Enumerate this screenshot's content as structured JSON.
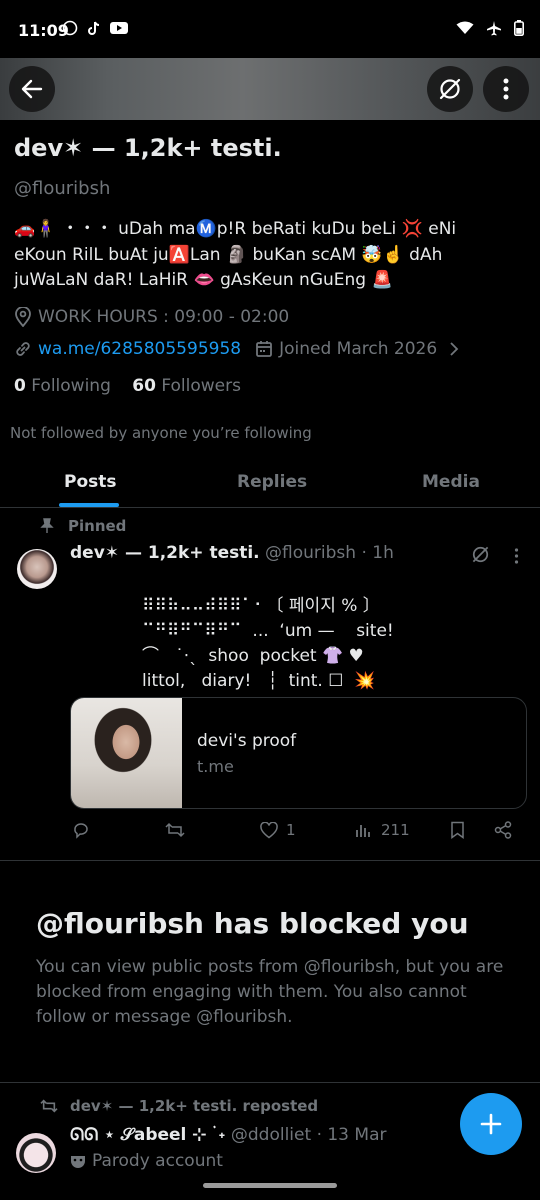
{
  "status": {
    "time": "11:09",
    "left_icons": [
      "whatsapp-icon",
      "tiktok-icon",
      "youtube-icon"
    ],
    "right_icons": [
      "wifi-icon",
      "airplane-icon",
      "battery-icon"
    ]
  },
  "profile": {
    "name": "dev✶ — 1,2k+ testi.",
    "handle": "@flouribsh",
    "bio": "🚗🧍‍♀️ ・・・ uDah maⓂ️p!R beRati kuDu beLi 💢 eNi eKoun RilL buAt ju🅰️Lan 🗿 buKan scAM 🤯☝️ dAh juWaLaN daR! LaHiR 👄 gAsKeun nGuEng 🚨",
    "location": "WORK HOURS : 09:00 - 02:00",
    "website": "wa.me/6285805595958",
    "joined": "Joined March 2026",
    "following_count": "0",
    "following_label": "Following",
    "followers_count": "60",
    "followers_label": "Followers",
    "not_followed": "Not followed by anyone you’re following"
  },
  "tabs": [
    {
      "label": "Posts",
      "active": true
    },
    {
      "label": "Replies",
      "active": false
    },
    {
      "label": "Media",
      "active": false
    }
  ],
  "pinned_post": {
    "pinned_label": "Pinned",
    "author_name": "dev✶ — 1,2k+ testi.",
    "author_handle": "@flouribsh",
    "time": "· 1h",
    "text": "⠿⠿⠷⠤⠤⠾⠿⠿⠁⠂〔 페이지 % 〕\n⠉⠛⠿⠛⠉⠿⠛⠉  ...  ‘um —    site!\n⌒   ˙⋅ˎ  shoo  pocket 👚 ♥\nlittol,   diary!   ┆  tint. ☐  💥",
    "card_title": "devi's proof",
    "card_domain": "t.me",
    "likes": "1",
    "views": "211"
  },
  "blocked": {
    "title": "@flouribsh has blocked you",
    "text": "You can view public posts from @flouribsh, but you are blocked from engaging with them. You also cannot follow or message @flouribsh."
  },
  "repost": {
    "label": "dev✶ — 1,2k+ testi. reposted",
    "author_name": "ᘏᘏ ⋆ 𝒮abeel ⊹ ࣪ ˖",
    "author_handle": "@ddolliet",
    "time": "· 13 Mar",
    "parody_label": "Parody account"
  },
  "colors": {
    "accent": "#1d9bf0",
    "background": "#000000",
    "text": "#e7e9ea",
    "muted": "#71767b"
  }
}
